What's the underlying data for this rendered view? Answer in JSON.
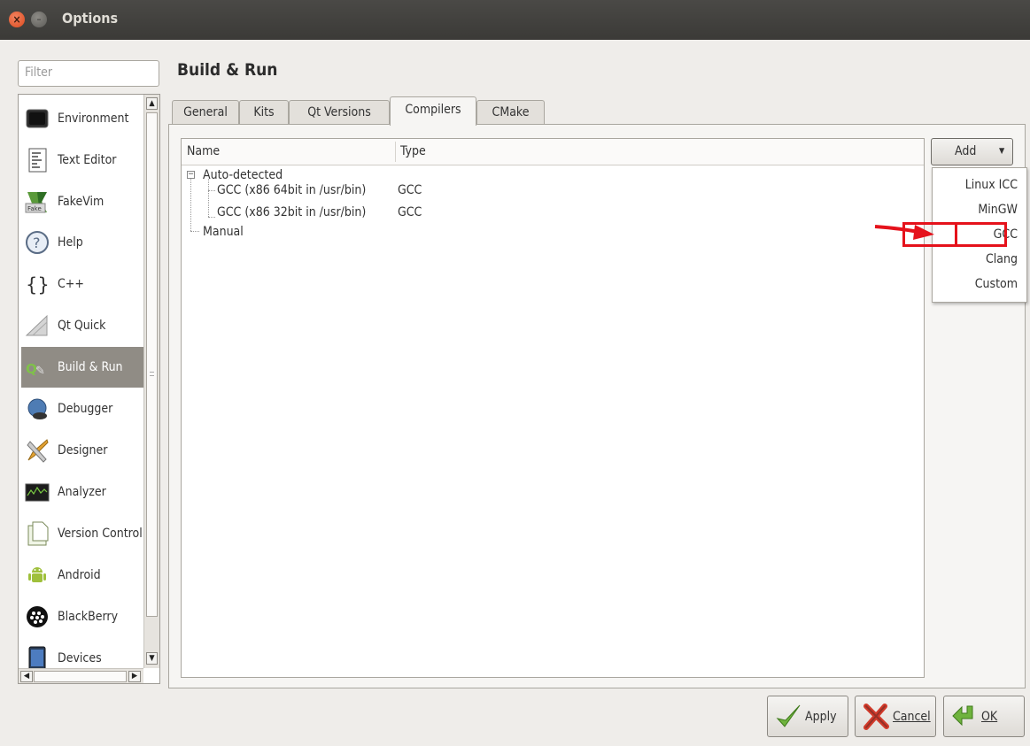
{
  "window": {
    "title": "Options"
  },
  "filter": {
    "placeholder": "Filter"
  },
  "sidebar": {
    "items": [
      {
        "label": "Environment"
      },
      {
        "label": "Text Editor"
      },
      {
        "label": "FakeVim"
      },
      {
        "label": "Help"
      },
      {
        "label": "C++"
      },
      {
        "label": "Qt Quick"
      },
      {
        "label": "Build & Run"
      },
      {
        "label": "Debugger"
      },
      {
        "label": "Designer"
      },
      {
        "label": "Analyzer"
      },
      {
        "label": "Version Control"
      },
      {
        "label": "Android"
      },
      {
        "label": "BlackBerry"
      },
      {
        "label": "Devices"
      }
    ],
    "selected": "Build & Run"
  },
  "page": {
    "title": "Build & Run"
  },
  "tabs": [
    {
      "label": "General"
    },
    {
      "label": "Kits"
    },
    {
      "label": "Qt Versions"
    },
    {
      "label": "Compilers"
    },
    {
      "label": "CMake"
    }
  ],
  "active_tab": "Compilers",
  "tree": {
    "columns": [
      "Name",
      "Type"
    ],
    "groups": [
      {
        "label": "Auto-detected",
        "children": [
          {
            "name": "GCC (x86 64bit in /usr/bin)",
            "type": "GCC"
          },
          {
            "name": "GCC (x86 32bit in /usr/bin)",
            "type": "GCC"
          }
        ]
      },
      {
        "label": "Manual",
        "children": []
      }
    ]
  },
  "add_button": {
    "label": "Add"
  },
  "add_menu": {
    "items": [
      "Linux ICC",
      "MinGW",
      "GCC",
      "Clang",
      "Custom"
    ],
    "highlighted": "GCC"
  },
  "buttons": {
    "apply": "Apply",
    "cancel": "Cancel",
    "ok": "OK"
  },
  "colors": {
    "annotation": "#e5121b",
    "selection": "#908c85"
  }
}
